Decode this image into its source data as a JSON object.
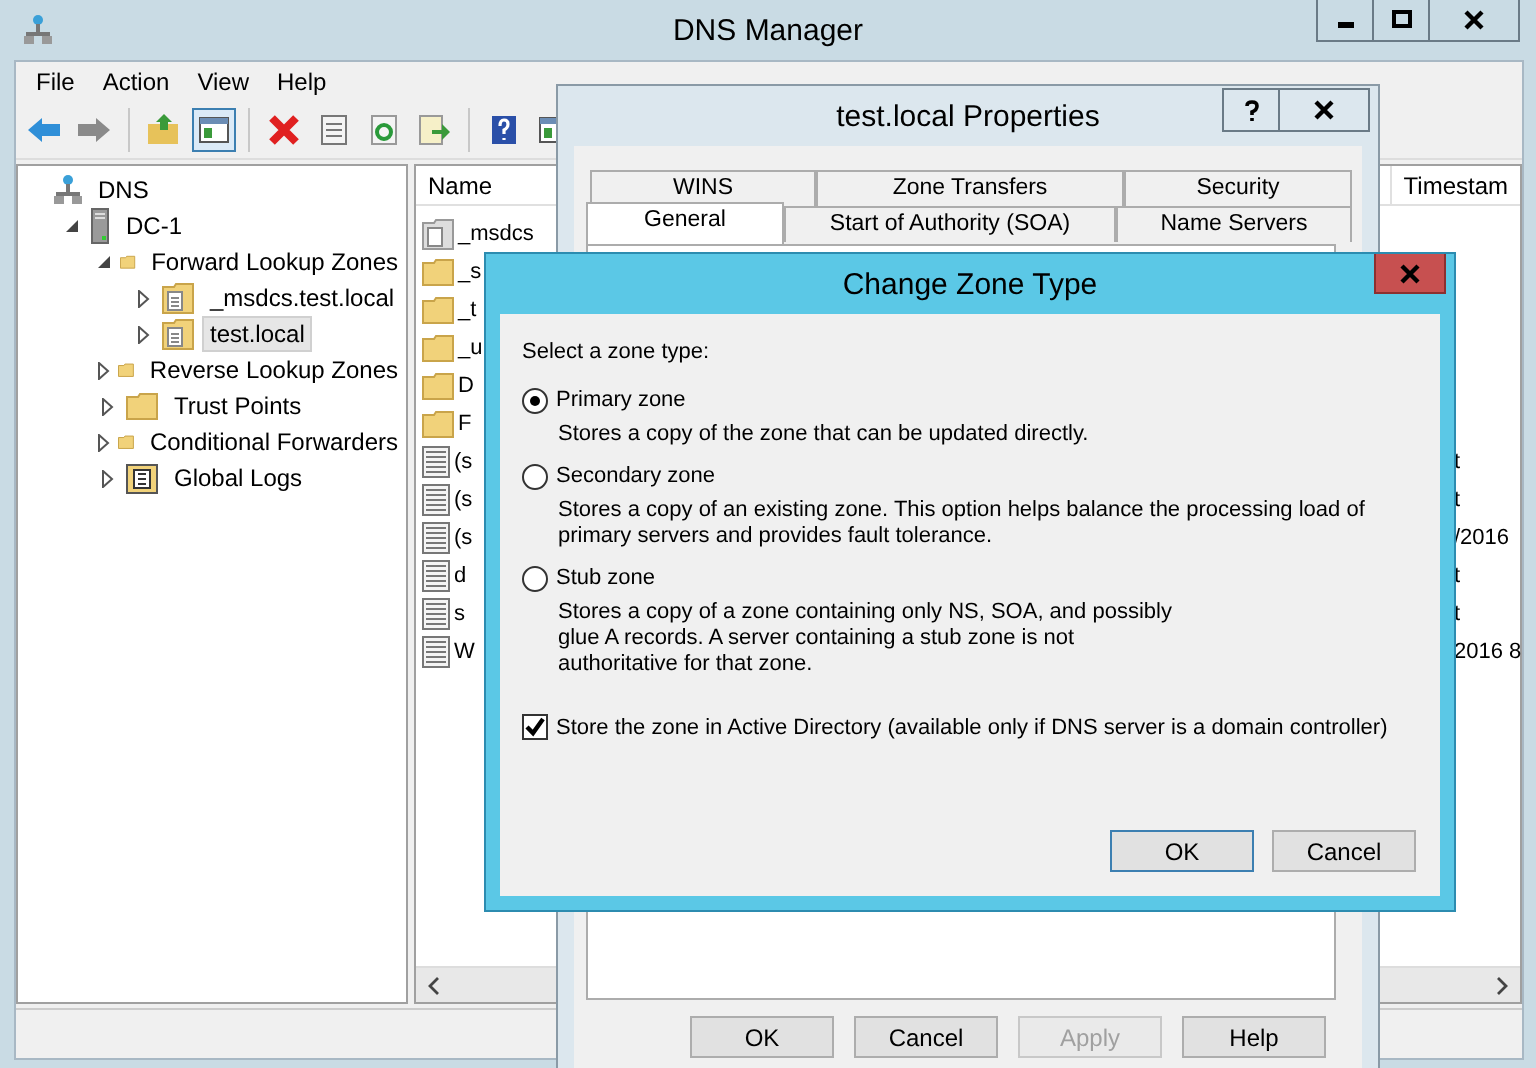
{
  "window": {
    "title": "DNS Manager"
  },
  "menu": [
    "File",
    "Action",
    "View",
    "Help"
  ],
  "toolbar": [
    {
      "kind": "back",
      "pressed": false
    },
    {
      "kind": "forward",
      "pressed": false
    },
    {
      "kind": "separator"
    },
    {
      "kind": "up",
      "pressed": false
    },
    {
      "kind": "pane",
      "pressed": true
    },
    {
      "kind": "separator"
    },
    {
      "kind": "delete",
      "pressed": false
    },
    {
      "kind": "properties",
      "pressed": false
    },
    {
      "kind": "refresh",
      "pressed": false
    },
    {
      "kind": "export",
      "pressed": false
    },
    {
      "kind": "separator"
    },
    {
      "kind": "help",
      "pressed": false
    },
    {
      "kind": "pane2",
      "pressed": false
    }
  ],
  "tree": [
    {
      "label": "DNS",
      "kind": "root",
      "selected": false,
      "children": [
        {
          "label": "DC-1",
          "kind": "server",
          "expanded": true,
          "selected": false,
          "children": [
            {
              "label": "Forward Lookup Zones",
              "kind": "folder",
              "expanded": true,
              "selected": false,
              "children": [
                {
                  "label": "_msdcs.test.local",
                  "kind": "zone",
                  "expanded": false,
                  "selected": false
                },
                {
                  "label": "test.local",
                  "kind": "zone",
                  "expanded": false,
                  "selected": true
                }
              ]
            },
            {
              "label": "Reverse Lookup Zones",
              "kind": "folder",
              "expanded": false,
              "selected": false
            },
            {
              "label": "Trust Points",
              "kind": "folder",
              "expanded": false,
              "selected": false
            },
            {
              "label": "Conditional Forwarders",
              "kind": "folder",
              "expanded": false,
              "selected": false
            },
            {
              "label": "Global Logs",
              "kind": "logs",
              "expanded": false,
              "selected": false
            }
          ]
        }
      ]
    }
  ],
  "list": {
    "columns": [
      "Name",
      "Timestam"
    ],
    "rows": [
      {
        "kind": "zone",
        "name": "_msdcs"
      },
      {
        "kind": "folder",
        "name": "_s"
      },
      {
        "kind": "folder",
        "name": "_t"
      },
      {
        "kind": "folder",
        "name": "_u"
      },
      {
        "kind": "folder",
        "name": "D"
      },
      {
        "kind": "folder",
        "name": "F"
      },
      {
        "kind": "record",
        "name": "(s",
        "column_2": "t"
      },
      {
        "kind": "record",
        "name": "(s",
        "column_2": "t"
      },
      {
        "kind": "record",
        "name": "(s",
        "column_2": "/2016"
      },
      {
        "kind": "record",
        "name": "d",
        "column_2": "t"
      },
      {
        "kind": "record",
        "name": "s",
        "column_2": "t"
      },
      {
        "kind": "record",
        "name": "W",
        "column_2": "2016 8"
      }
    ]
  },
  "properties_dialog": {
    "title": "test.local Properties",
    "tab_rows": [
      [
        {
          "label": "WINS",
          "selected": false
        },
        {
          "label": "Zone Transfers",
          "selected": false
        },
        {
          "label": "Security",
          "selected": false
        }
      ],
      [
        {
          "label": "General",
          "selected": true
        },
        {
          "label": "Start of Authority (SOA)",
          "selected": false
        },
        {
          "label": "Name Servers",
          "selected": false
        }
      ]
    ],
    "buttons": [
      {
        "label": "OK",
        "disabled": false
      },
      {
        "label": "Cancel",
        "disabled": false
      },
      {
        "label": "Apply",
        "disabled": true
      },
      {
        "label": "Help",
        "disabled": false
      }
    ]
  },
  "change_zone_dialog": {
    "title": "Change Zone Type",
    "prompt": "Select a zone type:",
    "options": [
      {
        "label": "Primary zone",
        "selected": true,
        "description": "Stores a copy of the zone that can be updated directly."
      },
      {
        "label": "Secondary zone",
        "selected": false,
        "description": "Stores a copy of an existing zone. This option helps balance the processing load of\nprimary servers and provides fault tolerance."
      },
      {
        "label": "Stub zone",
        "selected": false,
        "description": "Stores a copy of a zone containing only NS, SOA, and possibly\nglue A records. A server containing a stub zone is not\nauthoritative for that zone."
      }
    ],
    "checkbox": {
      "label": "Store the zone in Active Directory (available only if DNS server is a domain controller)",
      "checked": true
    },
    "buttons": [
      {
        "label": "OK",
        "default": true
      },
      {
        "label": "Cancel",
        "default": false
      }
    ]
  }
}
